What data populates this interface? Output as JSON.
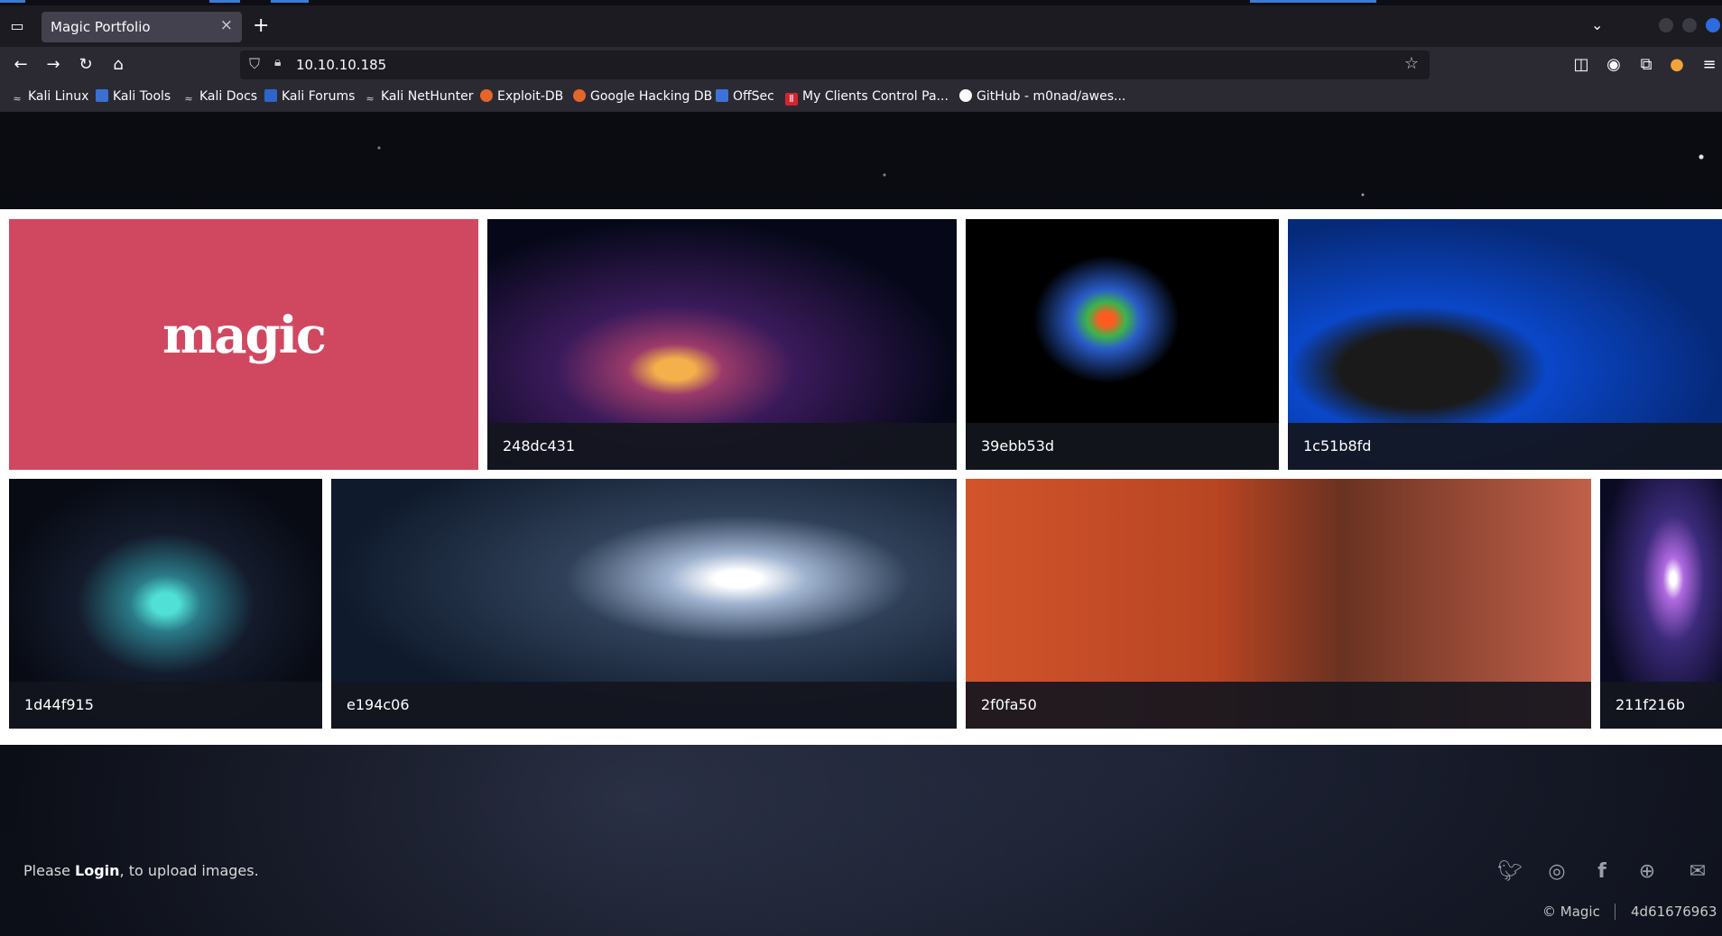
{
  "browser": {
    "tab": {
      "title": "Magic Portfolio",
      "close": "×"
    },
    "new_tab": "+",
    "url": "10.10.10.185",
    "bookmarks": [
      {
        "label": "Kali Linux",
        "icon": "kali-dragon-icon"
      },
      {
        "label": "Kali Tools",
        "icon": "kali-tools-icon"
      },
      {
        "label": "Kali Docs",
        "icon": "kali-dragon-icon"
      },
      {
        "label": "Kali Forums",
        "icon": "kali-forums-icon"
      },
      {
        "label": "Kali NetHunter",
        "icon": "kali-dragon-icon"
      },
      {
        "label": "Exploit-DB",
        "icon": "exploit-db-icon"
      },
      {
        "label": "Google Hacking DB",
        "icon": "exploit-db-icon"
      },
      {
        "label": "OffSec",
        "icon": "offsec-icon"
      },
      {
        "label": "My Clients Control Pa...",
        "icon": "clients-icon"
      },
      {
        "label": "GitHub - m0nad/awes...",
        "icon": "github-icon"
      }
    ]
  },
  "gallery": {
    "logo_text": "magic",
    "images": [
      {
        "caption": "248dc431"
      },
      {
        "caption": "39ebb53d"
      },
      {
        "caption": "1c51b8fd"
      },
      {
        "caption": "1d44f915"
      },
      {
        "caption": "e194c06"
      },
      {
        "caption": "2f0fa50"
      },
      {
        "caption": "211f216b"
      }
    ]
  },
  "footer": {
    "prefix": "Please ",
    "login_link": "Login",
    "suffix": ", to upload images.",
    "copyright": "© Magic",
    "hash": "4d61676963",
    "social": [
      "twitter-icon",
      "instagram-icon",
      "facebook-icon",
      "dribbble-icon",
      "mail-icon"
    ]
  },
  "colors": {
    "logo_tile": "#d04860",
    "caption_bar": "#14161e",
    "chrome_dark": "#1c1b22",
    "chrome_mid": "#2b2a33"
  }
}
